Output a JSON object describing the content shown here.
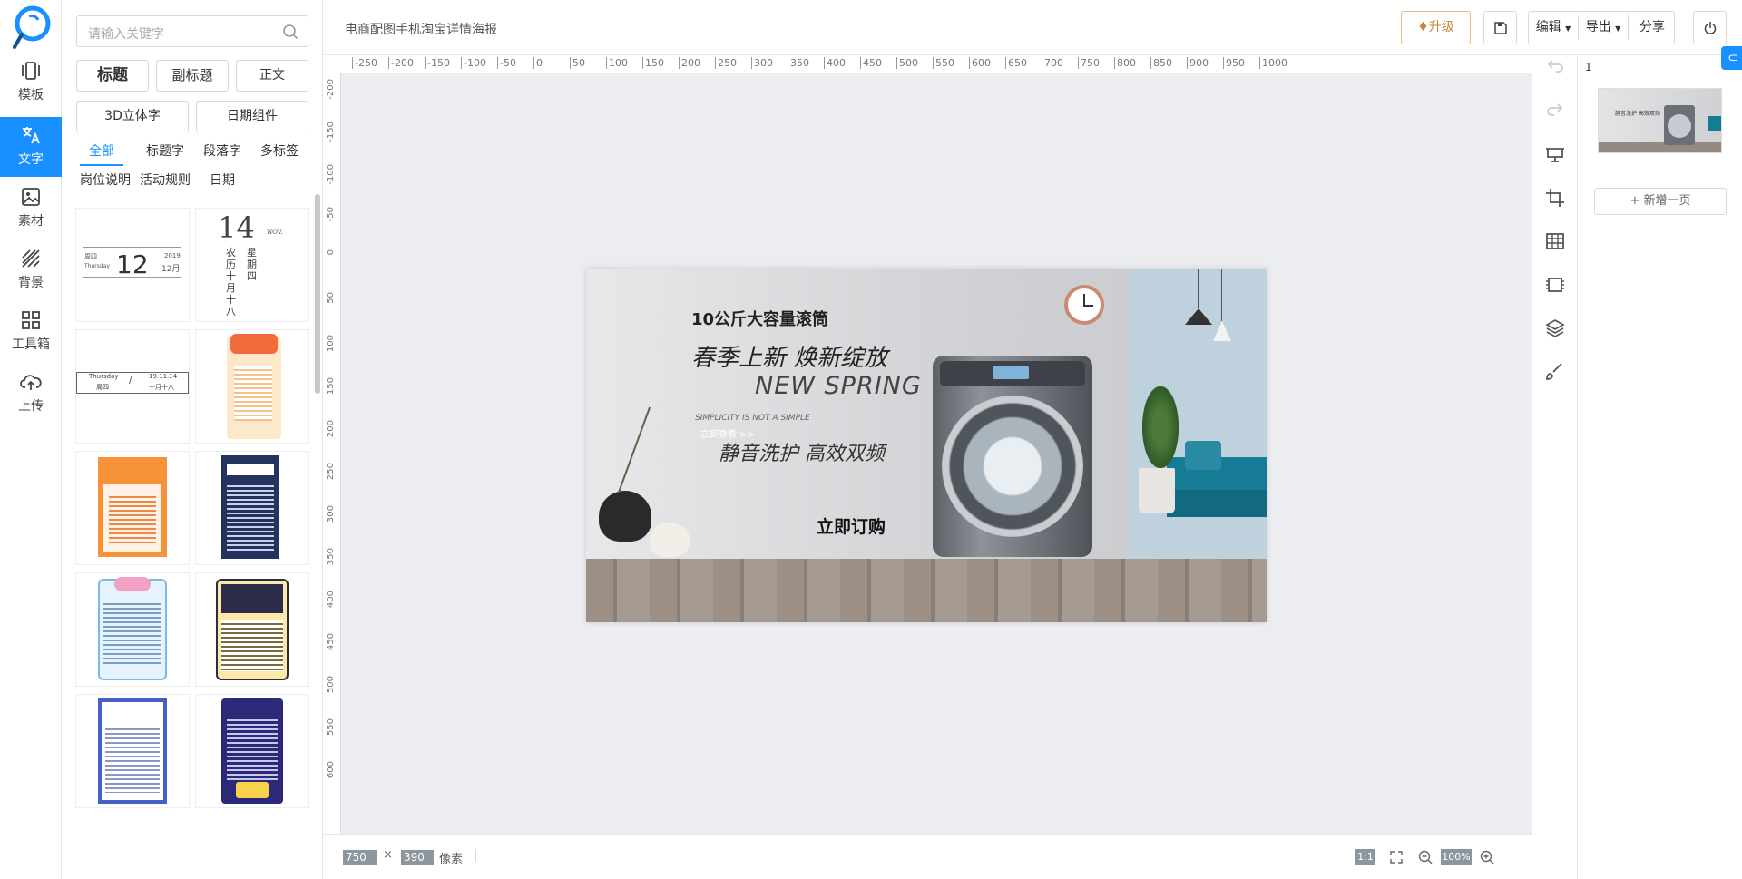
{
  "rail": {
    "items": [
      {
        "label": "模板",
        "icon": "phone-template-icon"
      },
      {
        "label": "文字",
        "icon": "translate-text-icon"
      },
      {
        "label": "素材",
        "icon": "image-icon"
      },
      {
        "label": "背景",
        "icon": "background-stripes-icon"
      },
      {
        "label": "工具箱",
        "icon": "grid-toolbox-icon"
      },
      {
        "label": "上传",
        "icon": "cloud-upload-icon"
      }
    ],
    "active": 1
  },
  "panel": {
    "search_placeholder": "请输入关键字",
    "style_buttons": [
      "标题",
      "副标题",
      "正文"
    ],
    "component_buttons": [
      "3D立体字",
      "日期组件"
    ],
    "tabs": [
      "全部",
      "标题字",
      "段落字",
      "多标签",
      "岗位说明",
      "活动规则",
      "日期"
    ],
    "date_card_1": {
      "weekday": "周四",
      "weekday_en": "Thursday",
      "day": "12",
      "year": "2019",
      "month": "12月"
    },
    "date_card_2": {
      "day": "14",
      "month_en": "NOV.",
      "lunar": "农历十月十八",
      "weekday": "星期四"
    },
    "date_card_3": {
      "weekday_en": "Thursday",
      "weekday": "周四",
      "date": "19.11.14",
      "lunar": "十月十八"
    }
  },
  "topbar": {
    "doc_title": "电商配图手机淘宝详情海报",
    "upgrade": "升级",
    "edit": "编辑",
    "export": "导出",
    "share": "分享"
  },
  "rulers": {
    "top": [
      "-250",
      "-200",
      "-150",
      "-100",
      "-50",
      "0",
      "50",
      "100",
      "150",
      "200",
      "250",
      "300",
      "350",
      "400",
      "450",
      "500",
      "550",
      "600",
      "650",
      "700",
      "750",
      "800",
      "850",
      "900",
      "950",
      "1000"
    ],
    "left": [
      "-200",
      "-150",
      "-100",
      "-50",
      "0",
      "50",
      "100",
      "150",
      "200",
      "250",
      "300",
      "350",
      "400",
      "450",
      "500",
      "550",
      "600"
    ]
  },
  "poster": {
    "headline": "10公斤大容量滚筒",
    "slogan1": "春季上新 焕新绽放",
    "slogan2": "NEW SPRING",
    "small_en": "SIMPLICITY IS NOT A SIMPLE",
    "link": "立即查看 >>",
    "slogan3": "静音洗护 高效双频",
    "cta": "立即订购"
  },
  "bottombar": {
    "width": "750",
    "height": "390",
    "unit": "像素",
    "ratio": "1:1",
    "zoom": "100%"
  },
  "pages": {
    "page_number": "1",
    "add_page": "+ 新增一页",
    "thumb_text": "静音洗护 高效双频"
  },
  "colors": {
    "accent": "#1890ff",
    "upgrade": "#c5873c"
  }
}
